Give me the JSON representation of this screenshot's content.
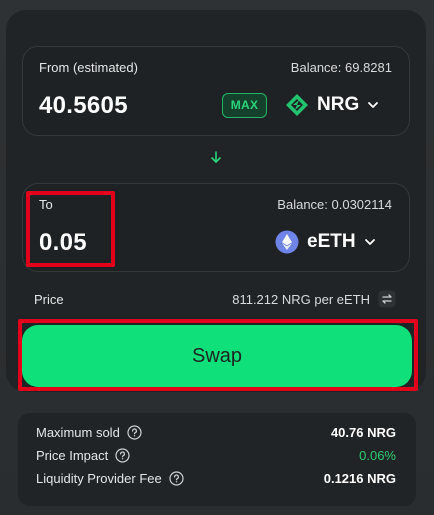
{
  "from": {
    "label": "From (estimated)",
    "balance": "Balance: 69.8281",
    "amount": "40.5605",
    "max_label": "MAX",
    "token": "NRG",
    "token_icon": "nrg-logo-icon"
  },
  "to": {
    "label": "To",
    "balance": "Balance: 0.0302114",
    "amount": "0.05",
    "token": "eETH",
    "token_icon": "eth-logo-icon"
  },
  "price": {
    "label": "Price",
    "value": "811.212 NRG per eETH"
  },
  "swap_label": "Swap",
  "details": [
    {
      "label": "Maximum sold",
      "value": "40.76 NRG"
    },
    {
      "label": "Price Impact",
      "value": "0.06%"
    },
    {
      "label": "Liquidity Provider Fee",
      "value": "0.1216 NRG"
    }
  ],
  "colors": {
    "accent": "#10e07a",
    "highlight": "#e3001b",
    "positive": "#2ecc71",
    "card": "#212426"
  }
}
